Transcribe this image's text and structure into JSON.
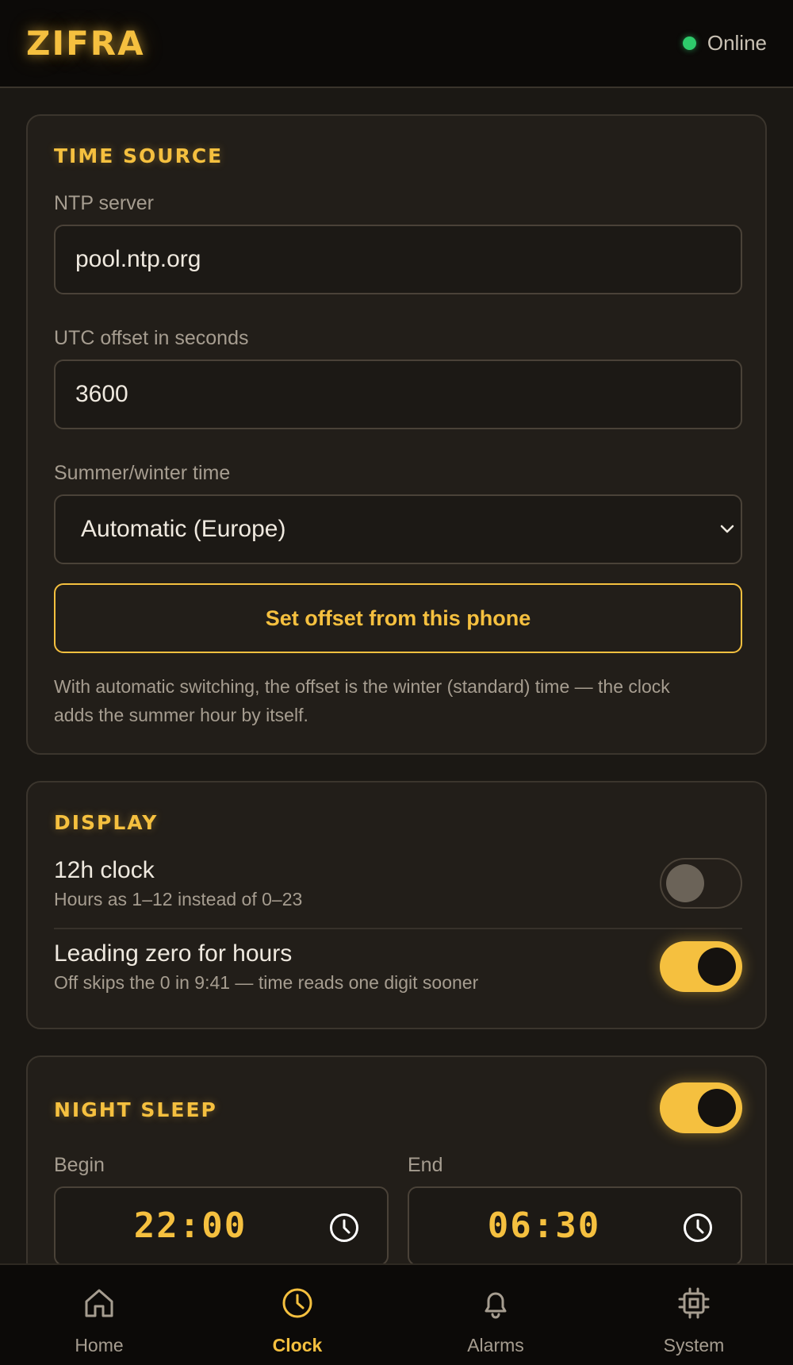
{
  "header": {
    "logo": "ZIFRA",
    "status": "Online"
  },
  "time_source": {
    "title": "TIME SOURCE",
    "ntp_label": "NTP server",
    "ntp_value": "pool.ntp.org",
    "utc_label": "UTC offset in seconds",
    "utc_value": "3600",
    "dst_label": "Summer/winter time",
    "dst_value": "Automatic (Europe)",
    "set_offset_button": "Set offset from this phone",
    "hint": "With automatic switching, the offset is the winter (standard) time — the clock adds the summer hour by itself."
  },
  "display": {
    "title": "DISPLAY",
    "clock12_title": "12h clock",
    "clock12_sub": "Hours as 1–12 instead of 0–23",
    "clock12_on": false,
    "leading_zero_title": "Leading zero for hours",
    "leading_zero_sub": "Off skips the 0 in 9:41 — time reads one digit sooner",
    "leading_zero_on": true
  },
  "night_sleep": {
    "title": "NIGHT SLEEP",
    "enabled": true,
    "begin_label": "Begin",
    "begin_value": "22:00",
    "end_label": "End",
    "end_value": "06:30"
  },
  "nav": {
    "items": [
      {
        "label": "Home",
        "icon": "home-icon",
        "active": false
      },
      {
        "label": "Clock",
        "icon": "clock-icon",
        "active": true
      },
      {
        "label": "Alarms",
        "icon": "bell-icon",
        "active": false
      },
      {
        "label": "System",
        "icon": "chip-icon",
        "active": false
      }
    ]
  },
  "colors": {
    "accent": "#f5c03f",
    "background": "#1b1814",
    "online": "#2ecb6b"
  }
}
